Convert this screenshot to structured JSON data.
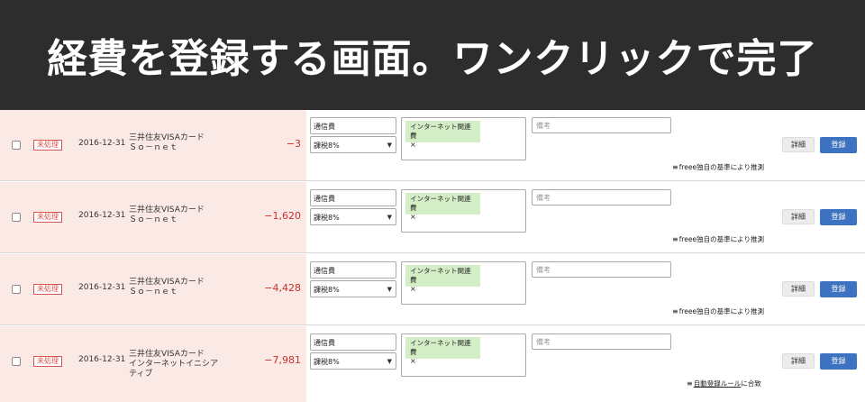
{
  "banner": {
    "title": "経費を登録する画面。ワンクリックで完了"
  },
  "rows": [
    {
      "status": "未処理",
      "date": "2016-12-31",
      "account_line1": "三井住友VISAカード",
      "account_line2": "Ｓｏ－ｎｅｔ",
      "account_line3": "",
      "amount": "−3",
      "category": "通信費",
      "tax": "課税8%",
      "tag": "インターネット関連費",
      "tag_remove": "×",
      "memo_placeholder": "備考",
      "detail_label": "詳細",
      "register_label": "登録",
      "hint_prefix": "freee独自の基準により推測",
      "hint_link": "",
      "hint_suffix": ""
    },
    {
      "status": "未処理",
      "date": "2016-12-31",
      "account_line1": "三井住友VISAカード",
      "account_line2": "Ｓｏ－ｎｅｔ",
      "account_line3": "",
      "amount": "−1,620",
      "category": "通信費",
      "tax": "課税8%",
      "tag": "インターネット関連費",
      "tag_remove": "×",
      "memo_placeholder": "備考",
      "detail_label": "詳細",
      "register_label": "登録",
      "hint_prefix": "freee独自の基準により推測",
      "hint_link": "",
      "hint_suffix": ""
    },
    {
      "status": "未処理",
      "date": "2016-12-31",
      "account_line1": "三井住友VISAカード",
      "account_line2": "Ｓｏ－ｎｅｔ",
      "account_line3": "",
      "amount": "−4,428",
      "category": "通信費",
      "tax": "課税8%",
      "tag": "インターネット関連費",
      "tag_remove": "×",
      "memo_placeholder": "備考",
      "detail_label": "詳細",
      "register_label": "登録",
      "hint_prefix": "freee独自の基準により推測",
      "hint_link": "",
      "hint_suffix": ""
    },
    {
      "status": "未処理",
      "date": "2016-12-31",
      "account_line1": "三井住友VISAカード",
      "account_line2": "インターネットイニシア",
      "account_line3": "ティブ",
      "amount": "−7,981",
      "category": "通信費",
      "tax": "課税8%",
      "tag": "インターネット関連費",
      "tag_remove": "×",
      "memo_placeholder": "備考",
      "detail_label": "詳細",
      "register_label": "登録",
      "hint_prefix": "",
      "hint_link": "自動登録ルール",
      "hint_suffix": "に合致"
    }
  ],
  "colors": {
    "banner_bg": "#2d2d2d",
    "row_left_bg": "#fbe9e5",
    "amount": "#c9302c",
    "tag_bg": "#d4eec8",
    "register_button": "#3d72c0"
  },
  "icons": {
    "hint": "list-check-icon",
    "select": "chevron-down-icon"
  }
}
